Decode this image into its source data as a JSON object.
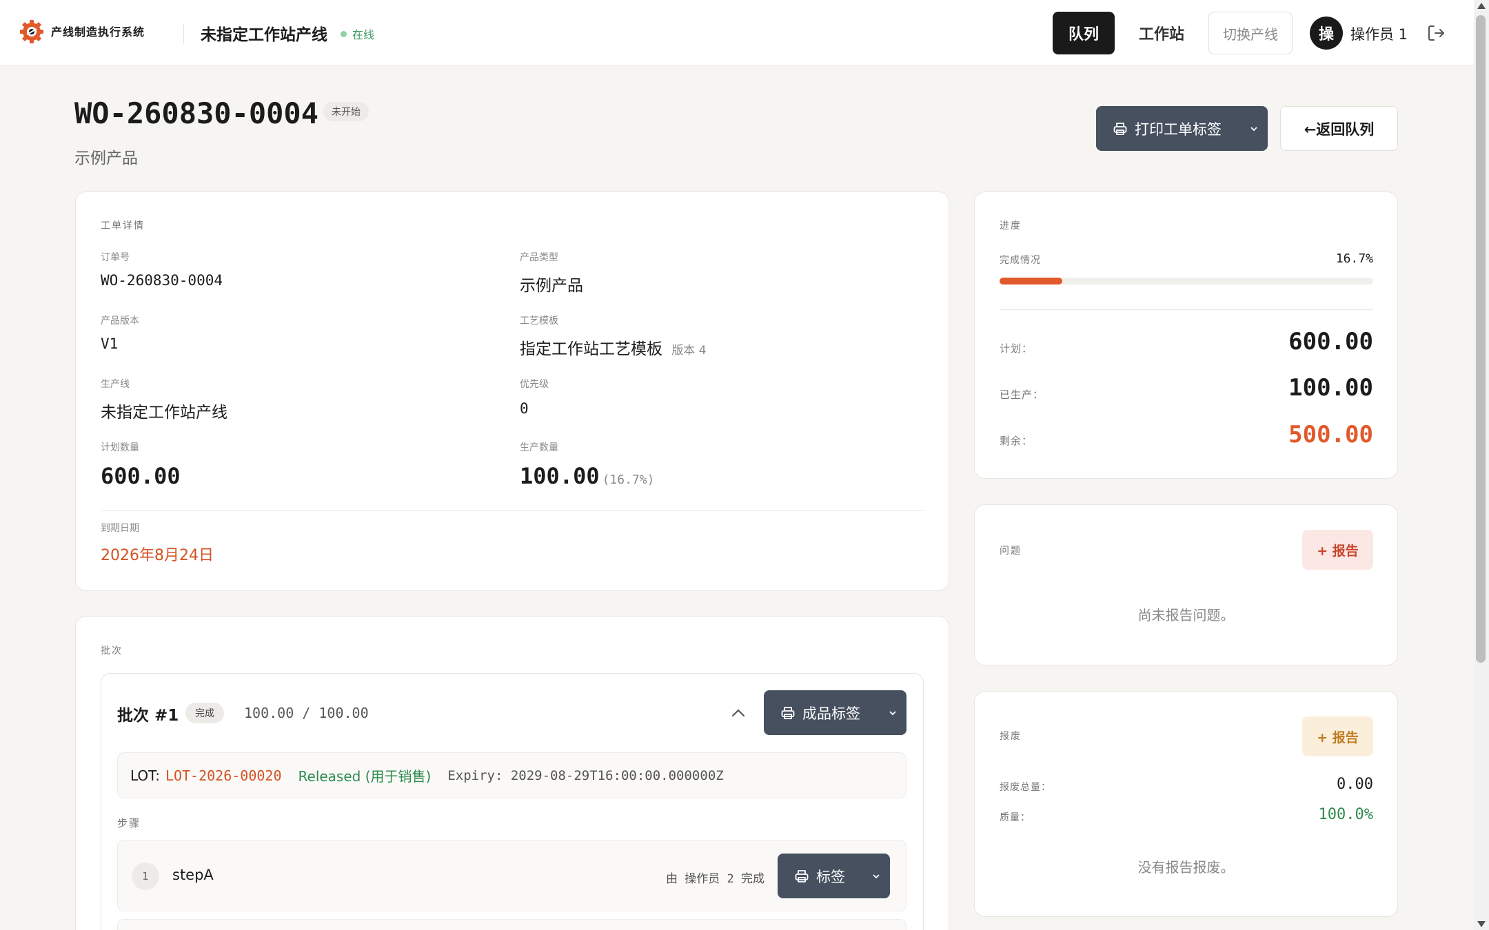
{
  "app": {
    "name": "产线制造执行系统",
    "line_name": "未指定工作站产线",
    "online_status": "在线"
  },
  "nav": {
    "queue": "队列",
    "station": "工作站",
    "switch_line": "切换产线",
    "avatar_char": "操",
    "user_name": "操作员 1"
  },
  "header": {
    "work_order": "WO-260830-0004",
    "status": "未开始",
    "product": "示例产品",
    "print_label": "打印工单标签",
    "back": "←返回队列"
  },
  "details": {
    "section": "工单详情",
    "order_no_label": "订单号",
    "order_no": "WO-260830-0004",
    "product_type_label": "产品类型",
    "product_type": "示例产品",
    "product_version_label": "产品版本",
    "product_version": "V1",
    "template_label": "工艺模板",
    "template": "指定工作站工艺模板",
    "template_version": "版本 4",
    "line_label": "生产线",
    "line": "未指定工作站产线",
    "priority_label": "优先级",
    "priority": "0",
    "planned_label": "计划数量",
    "planned": "600.00",
    "produced_label": "生产数量",
    "produced": "100.00",
    "produced_pct": "(16.7%)",
    "due_label": "到期日期",
    "due": "2026年8月24日"
  },
  "progress": {
    "section": "进度",
    "completion_label": "完成情况",
    "completion": "16.7%",
    "completion_fraction": 0.167,
    "plan_label": "计划：",
    "plan": "600.00",
    "produced_label": "已生产：",
    "produced": "100.00",
    "remaining_label": "剩余：",
    "remaining": "500.00"
  },
  "issues": {
    "section": "问题",
    "report": "+ 报告",
    "empty": "尚未报告问题。"
  },
  "scrap": {
    "section": "报废",
    "report": "+ 报告",
    "total_label": "报废总量：",
    "total": "0.00",
    "quality_label": "质量：",
    "quality": "100.0%",
    "empty": "没有报告报废。"
  },
  "batches": {
    "section": "批次",
    "batch_title": "批次 #1",
    "batch_status": "完成",
    "batch_qty": "100.00 / 100.00",
    "product_label_btn": "成品标签",
    "lot_key": "LOT:",
    "lot_code": "LOT-2026-00020",
    "lot_status": "Released (用于销售)",
    "lot_expiry": "Expiry: 2029-08-29T16:00:00.000000Z",
    "steps_label": "步骤",
    "steps": [
      {
        "num": "1",
        "name": "stepA",
        "by": "由 操作员 2 完成",
        "label_btn": "标签"
      }
    ]
  },
  "colors": {
    "accent_orange": "#e05a2b",
    "dark_button": "#46505f",
    "success_green": "#2e8b4e",
    "danger_red": "#d35323"
  }
}
